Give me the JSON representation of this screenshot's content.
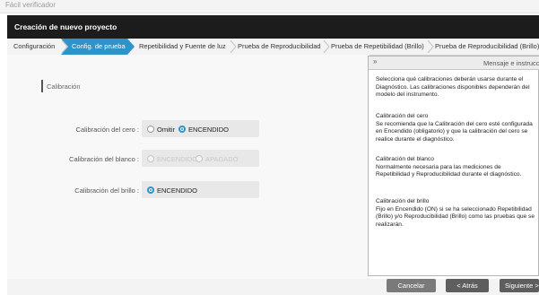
{
  "window": {
    "title": "Fácil verificador"
  },
  "header": {
    "title": "Creación de nuevo proyecto"
  },
  "tabs": [
    {
      "label": "Configuración",
      "active": false
    },
    {
      "label": "Config. de prueba",
      "active": true
    },
    {
      "label": "Repetibilidad y Fuente de luz",
      "active": false
    },
    {
      "label": "Prueba de Reproducibilidad",
      "active": false
    },
    {
      "label": "Prueba de Repetibilidad (Brillo)",
      "active": false
    },
    {
      "label": "Prueba de Reproducibilidad (Brillo)",
      "active": false
    }
  ],
  "section": {
    "title": "Calibración"
  },
  "rows": [
    {
      "label": "Calibración del cero :",
      "options": [
        {
          "label": "Omitir",
          "selected": false
        },
        {
          "label": "ENCENDIDO",
          "selected": true
        }
      ]
    },
    {
      "label": "Calibración del blanco :",
      "options": [
        {
          "label": "ENCENDIDO",
          "selected": true,
          "disabled": true
        },
        {
          "label": "APAGADO",
          "selected": false,
          "disabled": true
        }
      ]
    },
    {
      "label": "Calibración del brillo :",
      "options": [
        {
          "label": "ENCENDIDO",
          "selected": true
        }
      ]
    }
  ],
  "panel": {
    "title": "Mensaje e instrucción",
    "toggle_icon": "chevron-double-right-icon",
    "paragraphs": [
      "Selecciona qué calibraciones deberán usarse durante el Diagnóstico. Las calibraciones disponibles dependerán del modelo del instrumento.",
      "Calibración del cero\nSe recomienda que la Calibración del cero esté configurada en Encendido (obligatorio) y que la calibración del cero se realice durante el diagnóstico.",
      "Calibración del blanco\nNormalmente necesaria para las mediciones de Repetibilidad y Reproducibilidad durante el diagnóstico.",
      "Calibración del brillo\nFijo en Encendido (ON) si se ha seleccionado Repetibilidad (Brillo) y/o Reproducibilidad (Brillo) como las pruebas que se realizarán."
    ]
  },
  "footer": {
    "cancel_label": "Cancelar",
    "back_label": "< Atrás",
    "next_label": "Siguiente >"
  },
  "colors": {
    "accent": "#2d93c8",
    "header_bg": "#1c1c1c",
    "button_bg": "#6a6a6a"
  }
}
